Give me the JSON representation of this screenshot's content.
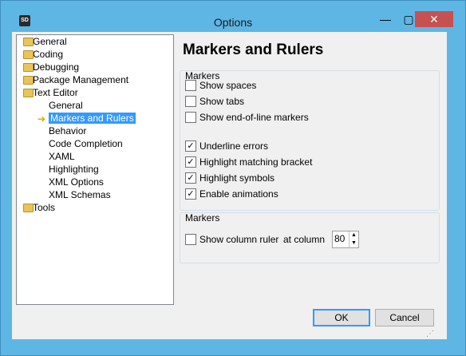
{
  "window": {
    "title": "Options",
    "app_icon_text": "SD",
    "minimize_glyph": "—",
    "maximize_glyph": "▢",
    "close_glyph": "✕"
  },
  "tree": {
    "items": [
      {
        "label": "General",
        "icon": "folder-icon"
      },
      {
        "label": "Coding",
        "icon": "folder-icon"
      },
      {
        "label": "Debugging",
        "icon": "folder-icon"
      },
      {
        "label": "Package Management",
        "icon": "folder-icon"
      },
      {
        "label": "Text Editor",
        "icon": "folder-open-icon"
      },
      {
        "label": "General"
      },
      {
        "label": "Markers and Rulers",
        "selected": true,
        "icon": "arrow-right-icon"
      },
      {
        "label": "Behavior"
      },
      {
        "label": "Code Completion"
      },
      {
        "label": "XAML"
      },
      {
        "label": "Highlighting"
      },
      {
        "label": "XML Options"
      },
      {
        "label": "XML Schemas"
      },
      {
        "label": "Tools",
        "icon": "folder-icon"
      }
    ]
  },
  "panel": {
    "title": "Markers and Rulers",
    "group1": {
      "title": "Markers",
      "options": [
        {
          "label": "Show spaces",
          "checked": false
        },
        {
          "label": "Show tabs",
          "checked": false
        },
        {
          "label": "Show end-of-line markers",
          "checked": false
        },
        {
          "label": "Underline errors",
          "checked": true
        },
        {
          "label": "Highlight matching bracket",
          "checked": true
        },
        {
          "label": "Highlight symbols",
          "checked": true
        },
        {
          "label": "Enable animations",
          "checked": true
        }
      ]
    },
    "group2": {
      "title": "Markers",
      "ruler_label": "Show column ruler",
      "ruler_checked": false,
      "at_column_label": "at column",
      "column_value": "80"
    }
  },
  "buttons": {
    "ok": "OK",
    "cancel": "Cancel"
  },
  "check_glyph": "✓",
  "colors": {
    "titlebar": "#5eb6e4",
    "selection": "#3399ff",
    "close_button": "#c75050"
  }
}
